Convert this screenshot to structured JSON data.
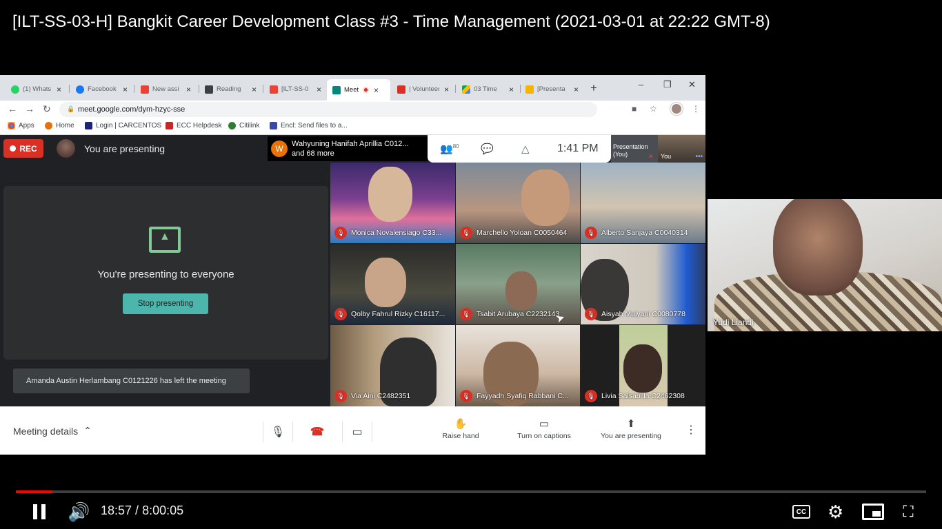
{
  "video": {
    "title": "[ILT-SS-03-H] Bangkit Career Development Class #3 - Time Management (2021-03-01 at 22:22 GMT-8)",
    "progress_fraction": 0.04,
    "time_current": "18:57",
    "time_separator": " / ",
    "time_total": "8:00:05",
    "played_color": "#ff0000"
  },
  "browser": {
    "tabs": [
      {
        "label": "(1) Whats",
        "icon": "whatsapp-icon",
        "color": "#25d366"
      },
      {
        "label": "Facebook",
        "icon": "facebook-icon",
        "color": "#1877f2"
      },
      {
        "label": "New assi",
        "icon": "gmail-icon",
        "color": "#ea4335"
      },
      {
        "label": "Reading",
        "icon": "classroom-icon",
        "color": "#3c4043"
      },
      {
        "label": "[ILT-SS-0",
        "icon": "gmail-icon",
        "color": "#ea4335"
      },
      {
        "label": "Meet",
        "icon": "meet-icon",
        "color": "#00897b",
        "active": true
      },
      {
        "label": "| Volunteer",
        "icon": "volunteer-icon",
        "color": "#d93025"
      },
      {
        "label": "03 Time",
        "icon": "drive-icon",
        "color": "#fbbc04"
      },
      {
        "label": "[Presenta",
        "icon": "slides-icon",
        "color": "#f4b400"
      }
    ],
    "url": "meet.google.com/dym-hzyc-sse",
    "bookmarks": [
      {
        "label": "Apps",
        "icon": "apps-grid-icon",
        "color": "#4285f4"
      },
      {
        "label": "Home",
        "icon": "home-icon",
        "color": "#e8710a"
      },
      {
        "label": "Login | CARCENTOS",
        "icon": "site-icon",
        "color": "#1a237e"
      },
      {
        "label": "ECC Helpdesk",
        "icon": "helpdesk-icon",
        "color": "#c62828"
      },
      {
        "label": "Citilink",
        "icon": "citilink-icon",
        "color": "#2e7d32"
      },
      {
        "label": "Encl: Send files to a...",
        "icon": "send-files-icon",
        "color": "#3949ab"
      }
    ]
  },
  "meet": {
    "rec_label": "REC",
    "presenting_label": "You are presenting",
    "notification": {
      "avatar_letter": "W",
      "line1": "Wahyuning Hanifah Aprillia C012...",
      "line2": "and 68 more"
    },
    "participants_count": "80",
    "clock": "1:41 PM",
    "selfview_presentation_label": "Presentation",
    "selfview_presentation_you": "(You)",
    "selfview_you_label": "You",
    "present_message": "You're presenting to everyone",
    "stop_button": "Stop presenting",
    "toast": "Amanda Austin Herlambang C0121226 has left the meeting",
    "tiles": [
      {
        "name": "Monica Novalensiago C33...",
        "bg": "#5b3a8f"
      },
      {
        "name": "Marchello Yoloan C0050464",
        "bg": "#9e8a7a"
      },
      {
        "name": "Alberto Sanjaya C0040314",
        "bg": "#8fa3b5"
      },
      {
        "name": "Qolby Fahrul Rizky C16117...",
        "bg": "#3b3a36"
      },
      {
        "name": "Tsabit Arubaya C2232143",
        "bg": "#6b7a6a"
      },
      {
        "name": "Aisyah Mulyani C0080778",
        "bg": "#2f3a55"
      },
      {
        "name": "Via Aini C2482351",
        "bg": "#8a7a66"
      },
      {
        "name": "Fayyadh Syafiq Rabbani C...",
        "bg": "#a39686"
      },
      {
        "name": "Livia Salsabilla C2462308",
        "bg": "#1f1f1f"
      }
    ],
    "bottom": {
      "details_label": "Meeting details",
      "raise_hand": "Raise hand",
      "captions": "Turn on captions",
      "presenting": "You are presenting"
    }
  },
  "instructor": {
    "name": "Yudi Liandi"
  }
}
